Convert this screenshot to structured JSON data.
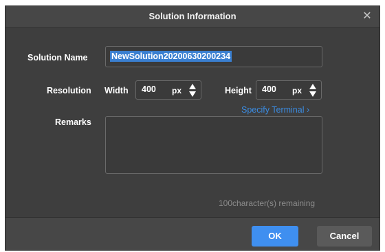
{
  "dialog": {
    "title": "Solution Information",
    "close_glyph": "✕"
  },
  "solution_name": {
    "label": "Solution Name",
    "value": "NewSolution20200630200234"
  },
  "resolution": {
    "label": "Resolution",
    "width": {
      "label": "Width",
      "value": "400",
      "unit": "px"
    },
    "height": {
      "label": "Height",
      "value": "400",
      "unit": "px"
    }
  },
  "specify_terminal": "Specify Terminal ›",
  "remarks": {
    "label": "Remarks",
    "value": "",
    "counter": "100character(s) remaining"
  },
  "footer": {
    "ok_label": "OK",
    "cancel_label": "Cancel"
  },
  "colors": {
    "accent": "#3f8ff0",
    "link": "#3b8be0",
    "background": "#3e3e3e"
  },
  "icons": [
    "close-icon",
    "arrow-up-icon",
    "arrow-down-icon",
    "chevron-right-icon"
  ]
}
